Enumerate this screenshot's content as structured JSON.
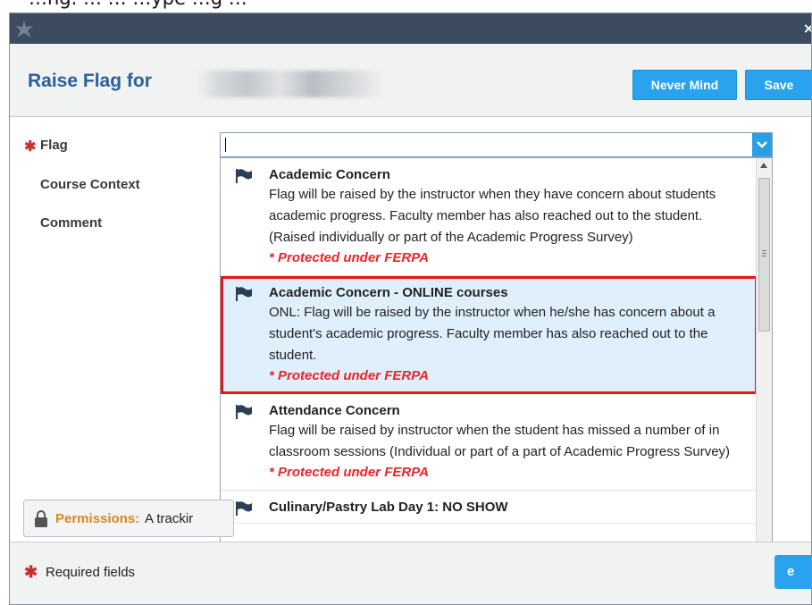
{
  "caption": "…ng. … … …ype …g …",
  "dialog": {
    "title": "Raise Flag for",
    "buttons": {
      "never_mind": "Never Mind",
      "save": "Save"
    }
  },
  "form": {
    "flag_label": "Flag",
    "course_context_label": "Course Context",
    "comment_label": "Comment",
    "flag_input_value": ""
  },
  "dropdown": {
    "items": [
      {
        "name": "Academic Concern",
        "desc": "Flag will be raised by the instructor when they have concern about students academic progress. Faculty member has also reached out to the student. (Raised individually or part of the Academic Progress Survey)",
        "ferpa": "* Protected under FERPA",
        "selected": false
      },
      {
        "name": "Academic Concern - ONLINE courses",
        "desc": "ONL: Flag will be raised by the instructor when he/she has concern about a student's academic progress. Faculty member has also reached out to the student.",
        "ferpa": "* Protected under FERPA",
        "selected": true
      },
      {
        "name": "Attendance Concern",
        "desc": "Flag will be raised by instructor when the student has missed a number of in classroom sessions (Individual or part of a part of Academic Progress Survey)",
        "ferpa": "* Protected under FERPA",
        "selected": false
      },
      {
        "name": "Culinary/Pastry Lab Day 1: NO SHOW",
        "desc": "",
        "ferpa": "",
        "selected": false
      }
    ]
  },
  "permissions": {
    "label": "Permissions:",
    "text": "A trackir"
  },
  "footer": {
    "required_text": "Required fields",
    "save_partial": "e"
  },
  "colors": {
    "titlebar": "#3d4b60",
    "title_blue": "#2b5f98",
    "button_blue": "#29a3ee",
    "ferpa_red": "#e8262a",
    "highlight_border": "#e0171f",
    "permissions_orange": "#e0861a"
  }
}
